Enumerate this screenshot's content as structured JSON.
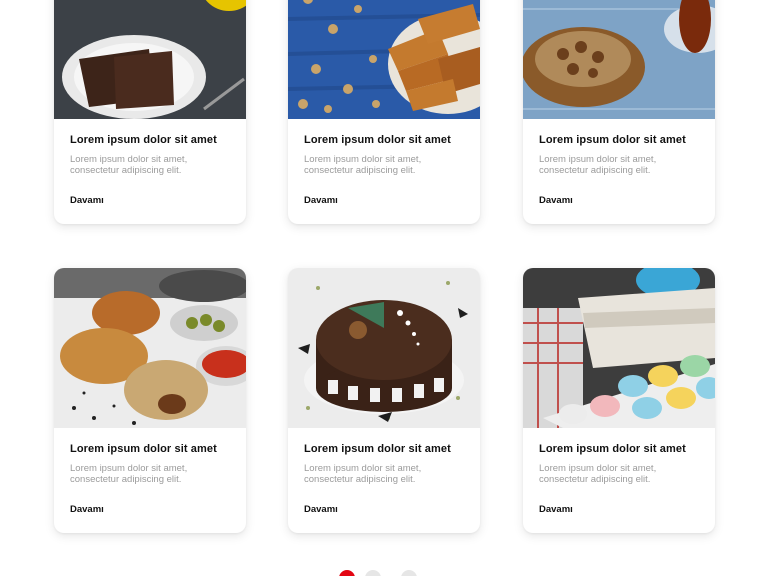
{
  "cards": [
    {
      "title": "Lorem ipsum dolor sit amet",
      "desc_line1": "Lorem ipsum dolor sit amet,",
      "desc_line2": "consectetur adipiscing elit.",
      "more": "Davamı",
      "image": "chocolate-cake-slices"
    },
    {
      "title": "Lorem ipsum dolor sit amet",
      "desc_line1": "Lorem ipsum dolor sit amet,",
      "desc_line2": "consectetur adipiscing elit.",
      "more": "Davamı",
      "image": "baklava-walnuts"
    },
    {
      "title": "Lorem ipsum dolor sit amet",
      "desc_line1": "Lorem ipsum dolor sit amet,",
      "desc_line2": "consectetur adipiscing elit.",
      "more": "Davamı",
      "image": "pastry-with-tea"
    },
    {
      "title": "Lorem ipsum dolor sit amet",
      "desc_line1": "Lorem ipsum dolor sit amet,",
      "desc_line2": "consectetur adipiscing elit.",
      "more": "Davamı",
      "image": "croissants-olives"
    },
    {
      "title": "Lorem ipsum dolor sit amet",
      "desc_line1": "Lorem ipsum dolor sit amet,",
      "desc_line2": "consectetur adipiscing elit.",
      "more": "Davamı",
      "image": "chocolate-cake-whole"
    },
    {
      "title": "Lorem ipsum dolor sit amet",
      "desc_line1": "Lorem ipsum dolor sit amet,",
      "desc_line2": "consectetur adipiscing elit.",
      "more": "Davamı",
      "image": "macarons-books"
    }
  ],
  "pagination": {
    "active_index": 0,
    "count": 3
  },
  "colors": {
    "accent": "#e30613",
    "inactive_dot": "#e6e6e6",
    "title": "#111111",
    "desc": "#9b9b9b"
  }
}
